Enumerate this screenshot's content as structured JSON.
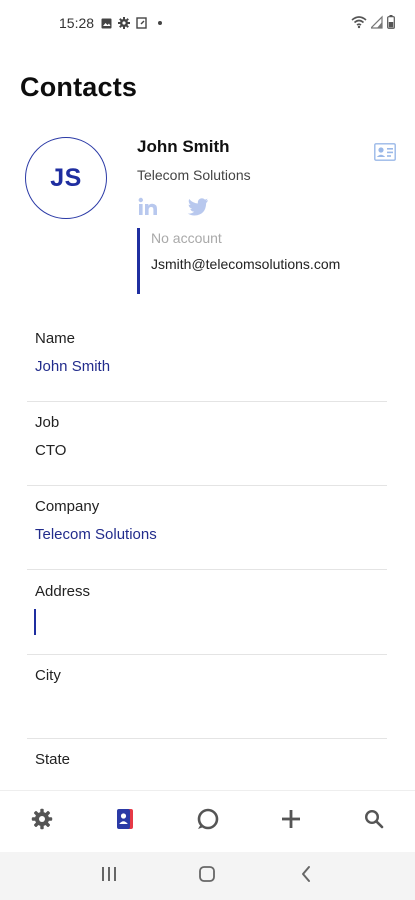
{
  "status_bar": {
    "time": "15:28",
    "left_icons": [
      "image-icon",
      "gear-icon",
      "screenshot-icon",
      "dot-icon"
    ],
    "right_icons": [
      "wifi-icon",
      "signal-icon",
      "battery-icon"
    ]
  },
  "page": {
    "title": "Contacts"
  },
  "contact": {
    "initials": "JS",
    "name": "John Smith",
    "company": "Telecom Solutions",
    "account_label": "No account",
    "email": "Jsmith@telecomsolutions.com"
  },
  "fields": [
    {
      "label": "Name",
      "value": "John Smith"
    },
    {
      "label": "Job",
      "value": "CTO"
    },
    {
      "label": "Company",
      "value": "Telecom Solutions"
    },
    {
      "label": "Address",
      "value": ""
    },
    {
      "label": "City",
      "value": ""
    },
    {
      "label": "State",
      "value": ""
    }
  ],
  "bottom_nav": [
    "gear-icon",
    "contacts-icon",
    "chat-icon",
    "plus-icon",
    "search-icon"
  ],
  "colors": {
    "accent": "#1f2ea0",
    "value_text": "#222c8c",
    "social_icon": "#b8c8ee",
    "divider": "#e4e4e4"
  }
}
